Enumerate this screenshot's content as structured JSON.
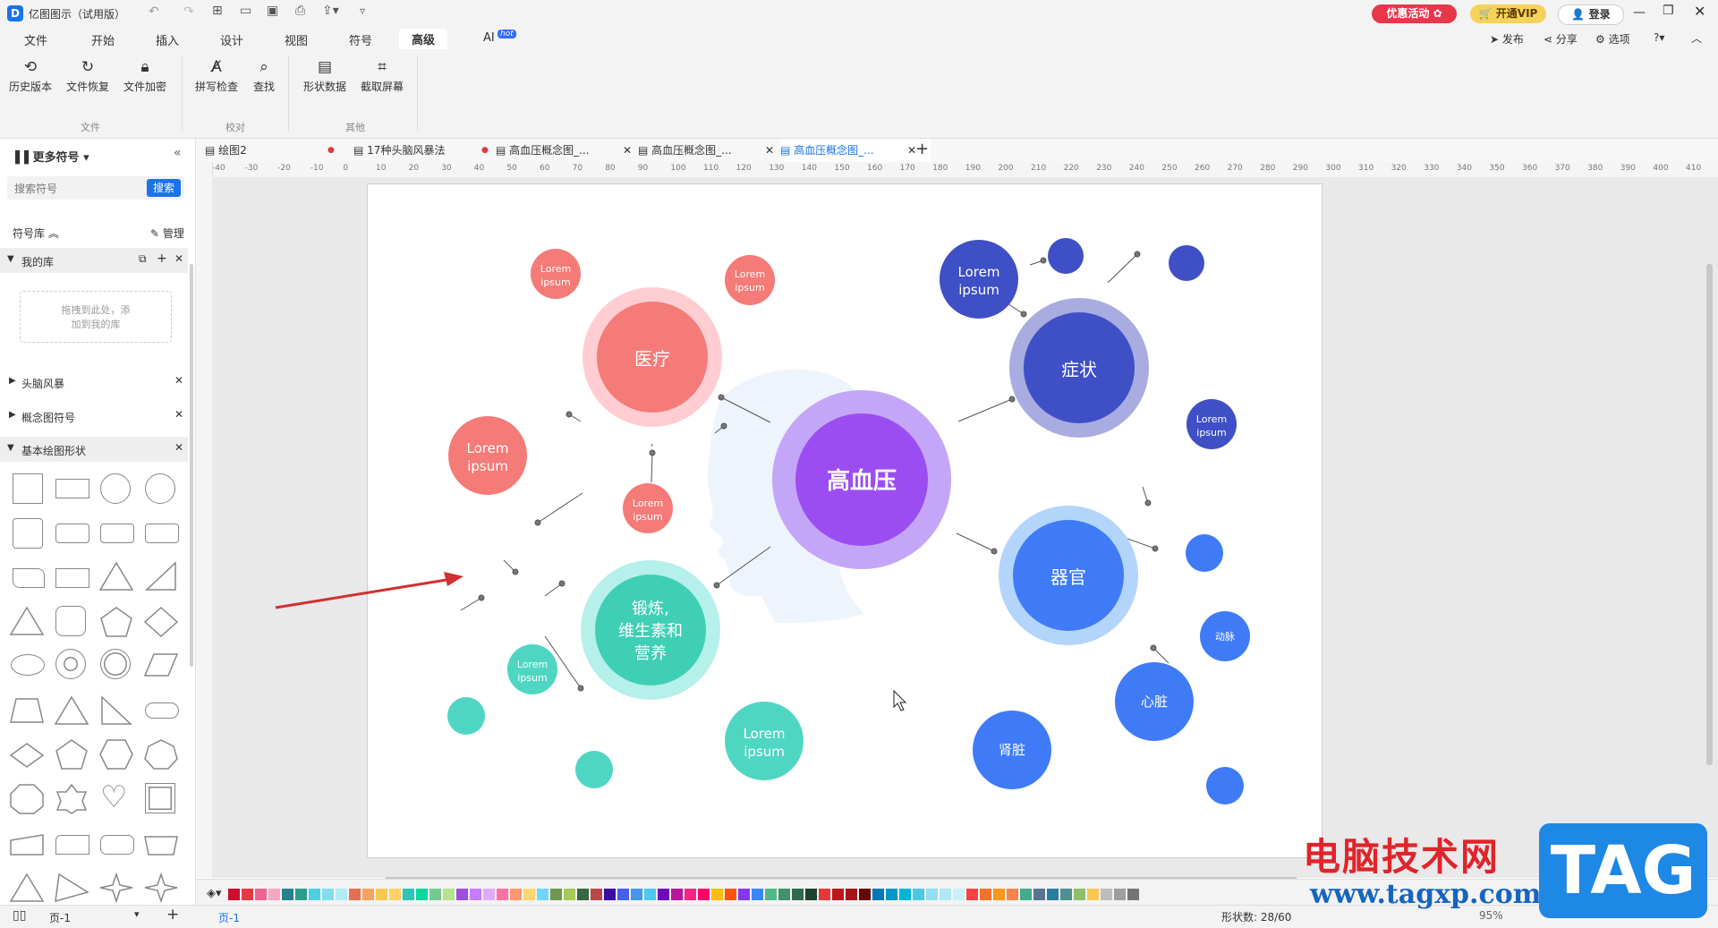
{
  "app": {
    "title": "亿图图示（试用版）",
    "promo": "优惠活动",
    "vip": "开通VIP",
    "login": "登录"
  },
  "menu": [
    "文件",
    "开始",
    "插入",
    "设计",
    "视图",
    "符号",
    "高级",
    "AI"
  ],
  "menu_badge": "hot",
  "menu_right": {
    "publish": "发布",
    "share": "分享",
    "options": "选项"
  },
  "ribbon": {
    "buttons": [
      {
        "label": "历史版本",
        "icon": "history-icon"
      },
      {
        "label": "文件恢复",
        "icon": "restore-icon"
      },
      {
        "label": "文件加密",
        "icon": "lock-icon"
      },
      {
        "label": "拼写检查",
        "icon": "spellcheck-icon"
      },
      {
        "label": "查找",
        "icon": "find-icon"
      },
      {
        "label": "形状数据",
        "icon": "shape-data-icon"
      },
      {
        "label": "截取屏幕",
        "icon": "crop-icon"
      }
    ],
    "groups": [
      "文件",
      "校对",
      "其他"
    ]
  },
  "sidebar": {
    "title": "更多符号",
    "search_placeholder": "搜索符号",
    "search_button": "搜索",
    "library_label": "符号库",
    "manage": "管理",
    "my_lib": "我的库",
    "drop_hint_1": "拖拽到此处，添",
    "drop_hint_2": "加到我的库",
    "categories": [
      "头脑风暴",
      "概念图符号",
      "基本绘图形状"
    ]
  },
  "tabs": [
    {
      "label": "绘图2",
      "dirty": true
    },
    {
      "label": "17种头脑风暴法",
      "dirty": true
    },
    {
      "label": "高血压概念图_...",
      "dirty": false
    },
    {
      "label": "高血压概念图_...",
      "dirty": false
    },
    {
      "label": "高血压概念图_...",
      "dirty": false
    }
  ],
  "ruler_labels": [
    "-40",
    "-30",
    "-20",
    "-10",
    "0",
    "10",
    "20",
    "30",
    "40",
    "50",
    "60",
    "70",
    "80",
    "90",
    "100",
    "110",
    "120",
    "130",
    "140",
    "150",
    "160",
    "170",
    "180",
    "190",
    "200",
    "210",
    "220",
    "230",
    "240",
    "250",
    "260",
    "270",
    "280",
    "290",
    "300",
    "310",
    "320",
    "330",
    "340",
    "350",
    "360",
    "370",
    "380",
    "390",
    "400",
    "410"
  ],
  "diagram": {
    "center": "高血压",
    "medical": "医疗",
    "symptom": "症状",
    "organ": "器官",
    "exercise_1": "锻炼,",
    "exercise_2": "维生素和",
    "exercise_3": "营养",
    "lorem_1": "Lorem",
    "lorem_2": "ipsum",
    "artery": "动脉",
    "heart": "心脏",
    "kidney": "肾脏"
  },
  "colors": {
    "accent": "#1a73e8",
    "coral": "#f47b78",
    "teal": "#4fd6c3",
    "indigo": "#3f4fc5",
    "blue": "#3f7bf7",
    "purple": "#9b4df2"
  },
  "palette": [
    "#c8102e",
    "#e63946",
    "#f06292",
    "#f8a5c2",
    "#26828e",
    "#2a9d8f",
    "#4dd0e1",
    "#80deea",
    "#b2ebf2",
    "#e76f51",
    "#f4a261",
    "#f9c74f",
    "#ffd166",
    "#2ec4b6",
    "#06d6a0",
    "#76c893",
    "#b5e48c",
    "#9d4edd",
    "#c77dff",
    "#e0aaff",
    "#ff70a6",
    "#ff9770",
    "#ffd670",
    "#70d6ff",
    "#6a994e",
    "#a7c957",
    "#386641",
    "#bc4749",
    "#3a0ca3",
    "#4361ee",
    "#4895ef",
    "#4cc9f0",
    "#7209b7",
    "#b5179e",
    "#f72585",
    "#ff006e",
    "#ffbe0b",
    "#fb5607",
    "#8338ec",
    "#3a86ff",
    "#52b788",
    "#40916c",
    "#2d6a4f",
    "#1b4332",
    "#e5383b",
    "#ba181b",
    "#a4161a",
    "#660708",
    "#0077b6",
    "#0096c7",
    "#00b4d8",
    "#48cae4",
    "#90e0ef",
    "#ade8f4",
    "#caf0f8",
    "#f94144",
    "#f3722c",
    "#f8961e",
    "#f9844a",
    "#43aa8b",
    "#577590",
    "#277da1",
    "#4d908e",
    "#90be6d",
    "#f9c74f",
    "#bdbdbd",
    "#9e9e9e",
    "#757575"
  ],
  "status": {
    "page": "页-1",
    "page_tab": "页-1",
    "shape_count": "形状数: 28/60",
    "zoom": "95%"
  },
  "watermark": {
    "site": "电脑技术网",
    "url": "www.tagxp.com",
    "tag": "TAG"
  }
}
